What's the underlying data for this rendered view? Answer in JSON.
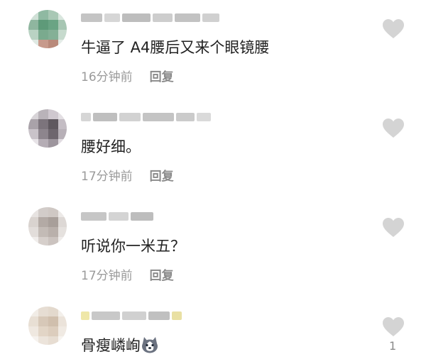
{
  "comments": [
    {
      "text": "牛逼了 A4腰后又来个眼镜腰",
      "time": "16分钟前",
      "reply": "回复",
      "likes": ""
    },
    {
      "text": "腰好细。",
      "time": "17分钟前",
      "reply": "回复",
      "likes": ""
    },
    {
      "text": "听说你一米五？",
      "time": "17分钟前",
      "reply": "回复",
      "likes": ""
    },
    {
      "text": "骨瘦嶙峋",
      "time": "",
      "reply": "",
      "likes": "1"
    }
  ],
  "icons": {
    "like": "heart-icon",
    "emoji": "husky-dog-emoji"
  },
  "colors": {
    "heart": "#d4d4d4",
    "text": "#222222",
    "meta": "#9a9a9a"
  }
}
